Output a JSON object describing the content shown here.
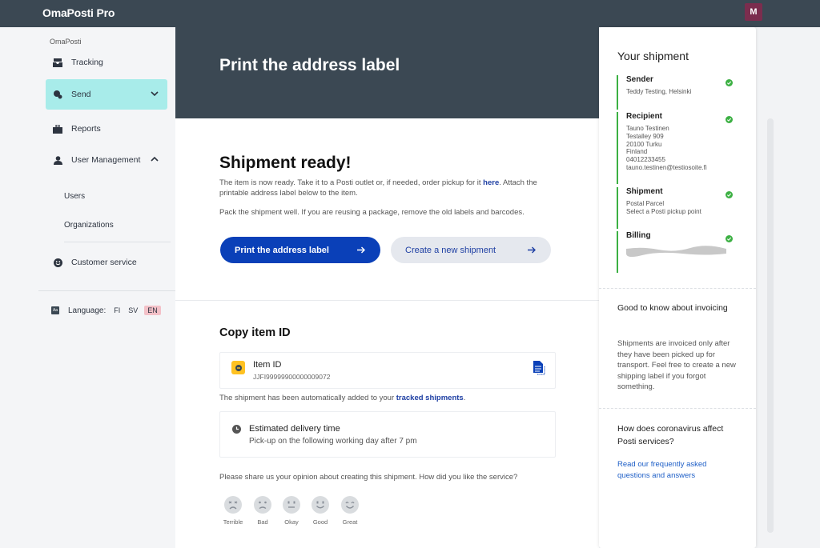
{
  "app": {
    "brand": "OmaPosti Pro",
    "avatar_initial": "M"
  },
  "sidebar": {
    "section_label": "OmaPosti",
    "items": [
      {
        "label": "Tracking",
        "icon": "tracking-tray-icon"
      },
      {
        "label": "Send",
        "icon": "send-parcel-icon",
        "active": true
      },
      {
        "label": "Reports",
        "icon": "briefcase-icon"
      },
      {
        "label": "User Management",
        "icon": "user-icon"
      },
      {
        "label": "Customer service",
        "icon": "smiley-icon"
      }
    ],
    "sub_items": [
      "Users",
      "Organizations"
    ],
    "language": {
      "label": "Language:",
      "options": [
        "FI",
        "SV",
        "EN"
      ],
      "selected": "EN"
    }
  },
  "hero": {
    "title": "Print the address label"
  },
  "main": {
    "ready_title": "Shipment ready!",
    "ready_text_1": "The item is now ready. Take it to a Posti outlet or, if needed, order pickup for it ",
    "ready_text_link": "here",
    "ready_text_2": ". Attach the printable address label below to the item.",
    "pack_text": "Pack the shipment well. If you are reusing a package, remove the old labels and barcodes.",
    "print_button": "Print the address label",
    "new_shipment_button": "Create a new shipment",
    "copy_title": "Copy item ID",
    "item_id_label": "Item ID",
    "item_id_value": "JJFI99999900000009072",
    "auto_added_text": "The shipment has been automatically added to your ",
    "auto_added_link": "tracked shipments",
    "auto_added_end": ".",
    "est_title": "Estimated delivery time",
    "est_sub": "Pick-up on the following working day after 7 pm",
    "opinion_text": "Please share us your opinion about creating this shipment. How did you like the service?",
    "ratings": [
      "Terrible",
      "Bad",
      "Okay",
      "Good",
      "Great"
    ]
  },
  "panel": {
    "title": "Your shipment",
    "steps": [
      {
        "title": "Sender",
        "lines": [
          "Teddy Testing, Helsinki"
        ]
      },
      {
        "title": "Recipient",
        "lines": [
          "Tauno Testinen",
          "Testalley 909",
          "20100 Turku",
          "Finland",
          "04012233455",
          "tauno.testinen@testiosoite.fi"
        ]
      },
      {
        "title": "Shipment",
        "lines": [
          "Postal Parcel",
          "Select a Posti pickup point"
        ]
      },
      {
        "title": "Billing",
        "lines": []
      }
    ],
    "invoicing_title": "Good to know about invoicing",
    "invoicing_body": "Shipments are invoiced only after they have been picked up for transport. Feel free to create a new shipping label if you forgot something.",
    "corona_title": "How does coronavirus affect Posti services?",
    "corona_link": "Read our frequently asked questions and answers"
  },
  "colors": {
    "header": "#3b4853",
    "primary": "#0a40b8",
    "active_nav": "#a8ecea",
    "success": "#3cb043"
  }
}
